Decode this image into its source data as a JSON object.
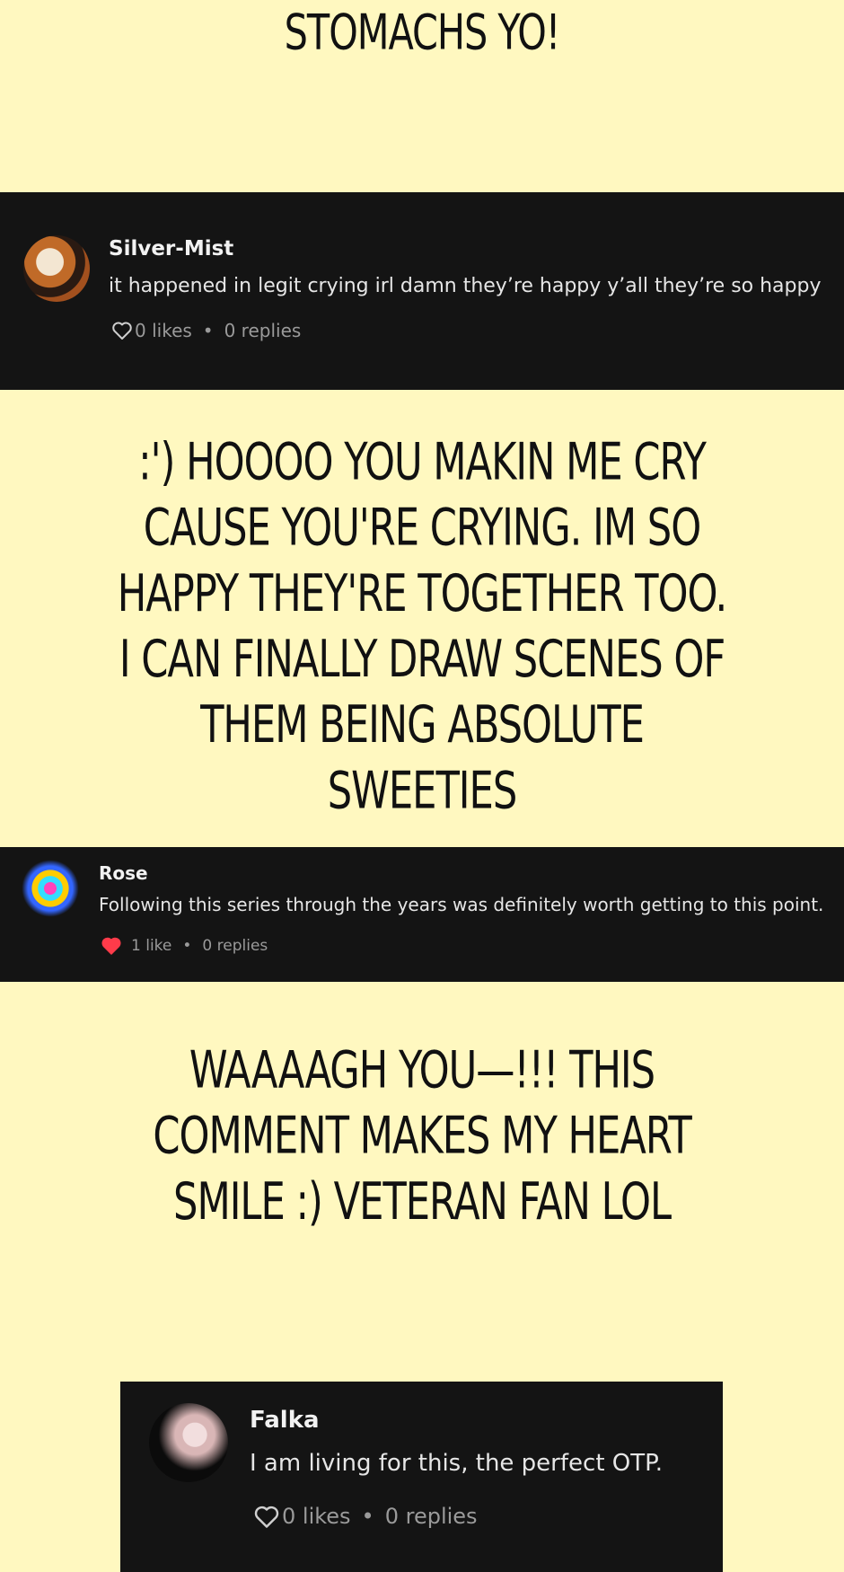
{
  "top_text": "STOMACHS YO!",
  "comments": [
    {
      "username": "Silver-Mist",
      "text": "it happened in legit crying irl damn they’re happy y’all they’re so happy",
      "likes": "0 likes",
      "replies": "0 replies",
      "liked": false,
      "avatar": "avatar"
    },
    {
      "username": "Rose",
      "text": "Following this series through the years was definitely worth getting to this point.",
      "likes": "1 like",
      "replies": "0 replies",
      "liked": true,
      "avatar": "avatar"
    },
    {
      "username": "Falka",
      "text": "I am living for this, the perfect OTP.",
      "likes": "0 likes",
      "replies": "0 replies",
      "liked": false,
      "avatar": "avatar"
    }
  ],
  "replies": [
    ":') HOOOO YOU MAKIN ME CRY CAUSE YOU'RE CRYING. IM SO HAPPY THEY'RE TOGETHER TOO. I CAN FINALLY DRAW SCENES OF THEM BEING ABSOLUTE SWEETIES",
    "WAAAAGH YOU—!!! THIS COMMENT MAKES MY HEART SMILE :) VETERAN FAN LOL"
  ],
  "separator": "•",
  "colors": {
    "background": "#fff8c0",
    "card": "#141414",
    "liked_heart": "#ff3b4a",
    "meta_text": "#9a9a9a"
  }
}
